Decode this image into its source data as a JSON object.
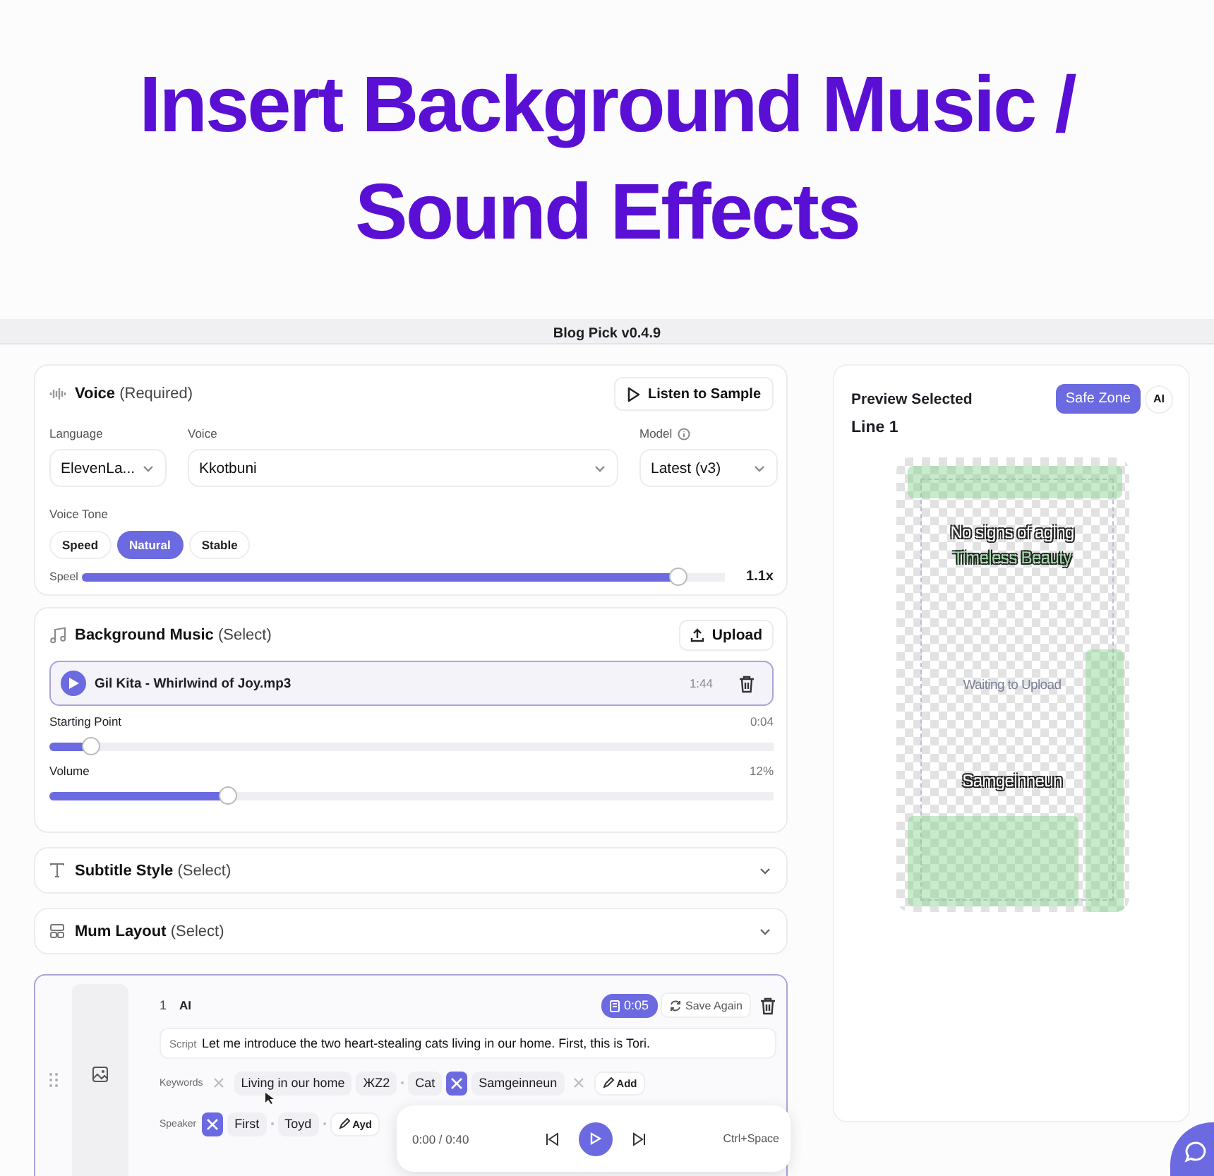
{
  "headline": {
    "lines": [
      "Insert Background Music /",
      "Sound Effects"
    ]
  },
  "window": {
    "title": "Blog Pick v0.4.9"
  },
  "voice_card": {
    "title": "**Voice** (Required)",
    "listen_button": "Listen to Sample",
    "fields": [
      {
        "label": "Language",
        "value": "ElevenLa..."
      },
      {
        "label": "Voice",
        "value": "Kkotbuni"
      },
      {
        "label": "Model",
        "value": "Latest (v3)",
        "info": true
      }
    ],
    "tone_label": "Voice Tone",
    "tones": [
      {
        "label": "Speed",
        "selected": false
      },
      {
        "label": "Natural",
        "selected": true
      },
      {
        "label": "Stable",
        "selected": false
      }
    ],
    "speed": {
      "label": "Speel",
      "level": 0.94,
      "reading": "1.1x"
    }
  },
  "music_card": {
    "title": "**Background Music** (Select)",
    "upload_button": "Upload",
    "track": {
      "name": "Gil Kita - Whirlwind of Joy.mp3",
      "duration": "1:44"
    },
    "sliders": [
      {
        "label": "Starting Point",
        "reading": "0:04",
        "level": 0.045
      },
      {
        "label": "Volume",
        "reading": "12%",
        "level": 0.24
      }
    ]
  },
  "sections": [
    {
      "kind": "text",
      "title": "**Subtitle Style** (Select)",
      "expanded": false
    },
    {
      "kind": "layout",
      "title": "**Mum Layout** (Select)",
      "expanded": false
    }
  ],
  "line_card": {
    "number": "1",
    "voice_tag": "AI",
    "duration": "0:05",
    "save_button": "Save Again",
    "script_label": "Script",
    "script": "Let me introduce the two heart-stealing cats living in our home. First, this is Tori.",
    "keywords_label": "Keywords",
    "keywords": [
      {
        "kind": "remove",
        "highlighted": false
      },
      {
        "kind": "chip",
        "text": "Living in our home"
      },
      {
        "kind": "chip",
        "text": "ЖZ2"
      },
      {
        "kind": "separator"
      },
      {
        "kind": "chip",
        "text": "Cat"
      },
      {
        "kind": "remove",
        "highlighted": true
      },
      {
        "kind": "chip",
        "text": "Samgeinneun"
      },
      {
        "kind": "remove",
        "highlighted": false
      },
      {
        "kind": "add",
        "text": "Add"
      }
    ],
    "speaker_label": "Speaker",
    "speakers": [
      {
        "kind": "remove",
        "highlighted": true
      },
      {
        "kind": "chip",
        "text": "First"
      },
      {
        "kind": "separator"
      },
      {
        "kind": "chip",
        "text": "Toyd"
      },
      {
        "kind": "separator"
      },
      {
        "kind": "add",
        "text": "Ayd"
      }
    ]
  },
  "player": {
    "time": "0:00 / 0:40",
    "shortcut": "Ctrl+Space"
  },
  "preview": {
    "title": "Preview Selected",
    "safe_zone_button": {
      "label": "Safe Zone",
      "selected": true
    },
    "ai_button": {
      "label": "AI",
      "selected": false
    },
    "line_label": "Line 1",
    "captions": [
      {
        "kind": "outlined",
        "text": "No signs of aging"
      },
      {
        "kind": "outlined_green",
        "text": "Timeless Beauty"
      },
      {
        "kind": "status",
        "text": "Waiting to Upload"
      },
      {
        "kind": "outlined",
        "text": "Samgeinneun"
      }
    ]
  }
}
